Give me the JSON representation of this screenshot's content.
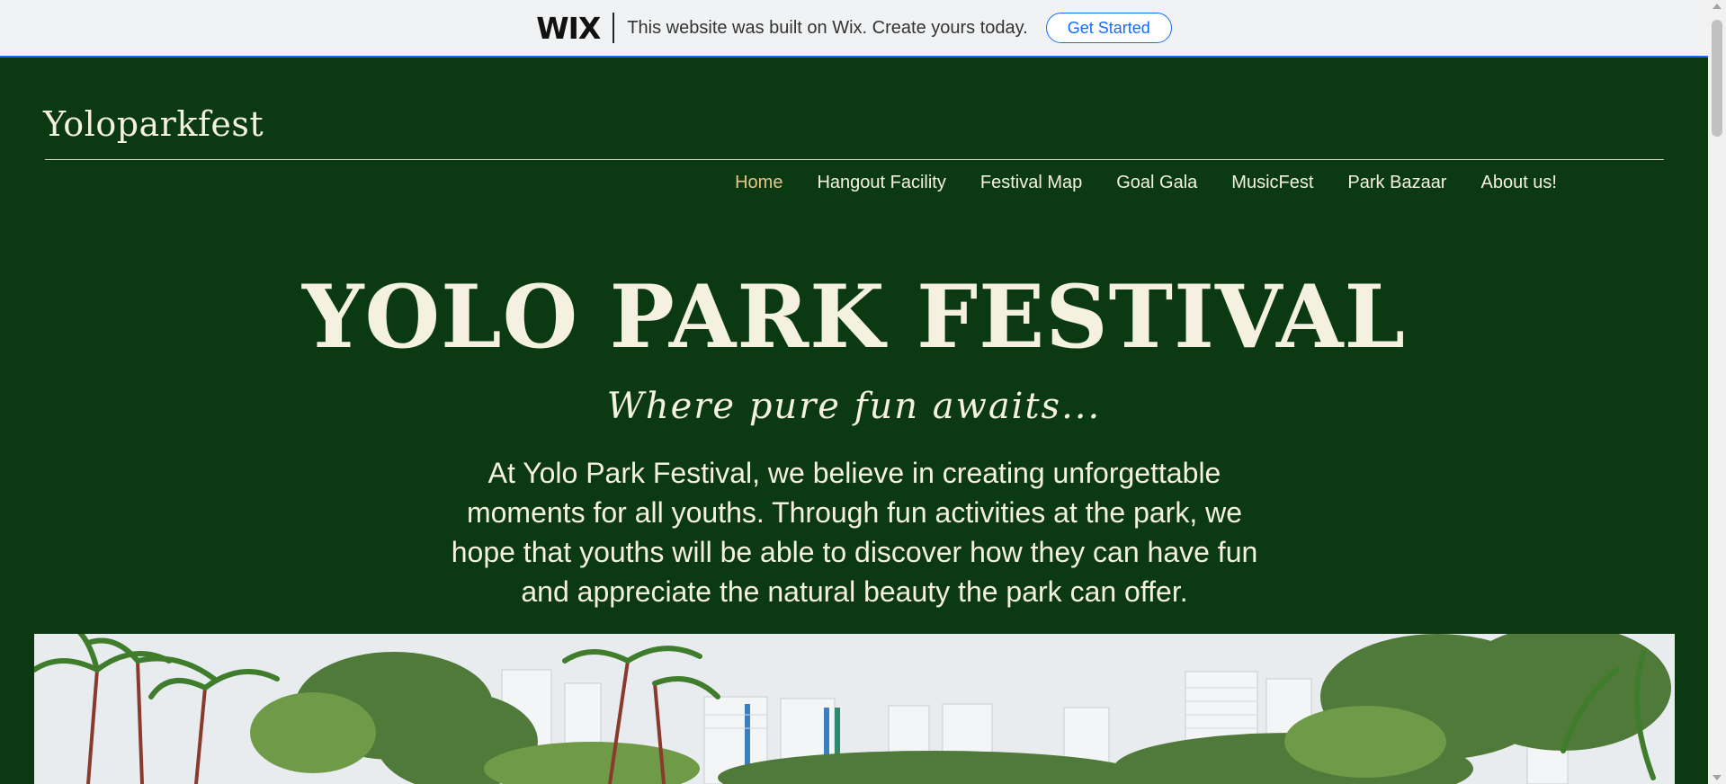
{
  "wix_banner": {
    "logo": "WIX",
    "message": "This website was built on Wix. Create yours today.",
    "cta_label": "Get Started"
  },
  "header": {
    "site_name": "Yoloparkfest"
  },
  "nav": {
    "items": [
      {
        "label": "Home",
        "active": true
      },
      {
        "label": "Hangout Facility",
        "active": false
      },
      {
        "label": "Festival Map",
        "active": false
      },
      {
        "label": "Goal Gala",
        "active": false
      },
      {
        "label": "MusicFest",
        "active": false
      },
      {
        "label": "Park Bazaar",
        "active": false
      },
      {
        "label": "About us!",
        "active": false
      }
    ]
  },
  "hero": {
    "title": "YOLO PARK FESTIVAL",
    "subtitle": "Where pure fun awaits...",
    "body": "At Yolo Park Festival, we believe in creating unforgettable moments for all youths. Through fun activities at the park, we hope that youths will be able to discover how they can have fun and appreciate the natural beauty the park can offer."
  },
  "colors": {
    "background": "#0b3a12",
    "text": "#f5f1e1",
    "nav_active": "#e8c48a",
    "wix_accent": "#116dff"
  }
}
